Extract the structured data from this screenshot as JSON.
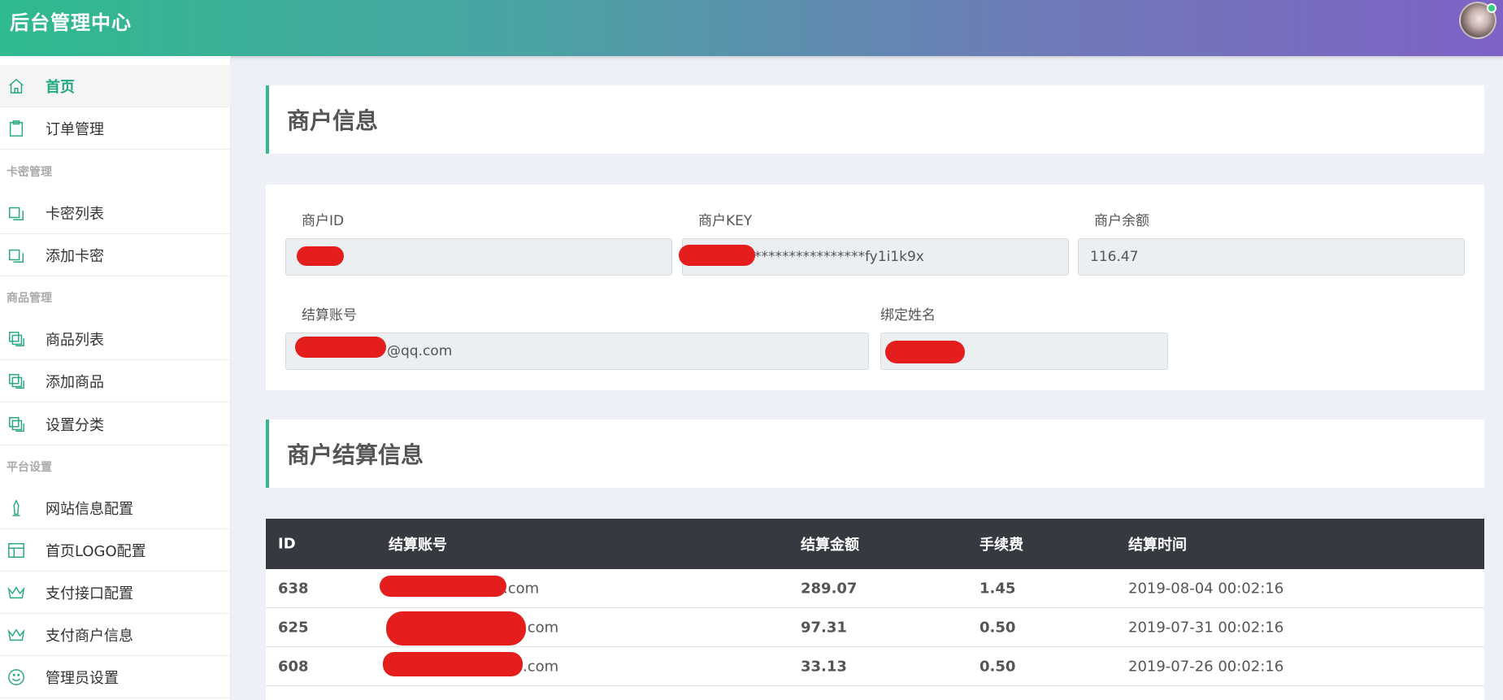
{
  "header": {
    "brand": "后台管理中心"
  },
  "sidebar": {
    "items": [
      {
        "label": "首页",
        "icon": "home-icon",
        "active": true
      },
      {
        "label": "订单管理",
        "icon": "clipboard-icon"
      },
      {
        "group": "卡密管理"
      },
      {
        "label": "卡密列表",
        "icon": "copy-icon"
      },
      {
        "label": "添加卡密",
        "icon": "copy-icon"
      },
      {
        "group": "商品管理"
      },
      {
        "label": "商品列表",
        "icon": "layers-icon"
      },
      {
        "label": "添加商品",
        "icon": "layers-icon"
      },
      {
        "label": "设置分类",
        "icon": "layers-icon"
      },
      {
        "group": "平台设置"
      },
      {
        "label": "网站信息配置",
        "icon": "pen-icon"
      },
      {
        "label": "首页LOGO配置",
        "icon": "layout-icon"
      },
      {
        "label": "支付接口配置",
        "icon": "crown-icon"
      },
      {
        "label": "支付商户信息",
        "icon": "crown-icon"
      },
      {
        "label": "管理员设置",
        "icon": "smile-icon"
      }
    ]
  },
  "merchant": {
    "title": "商户信息",
    "fields": {
      "id_label": "商户ID",
      "id_value": "",
      "key_label": "商户KEY",
      "key_value": "****************fy1i1k9x",
      "balance_label": "商户余额",
      "balance_value": "116.47",
      "account_label": "结算账号",
      "account_value": "@qq.com",
      "name_label": "绑定姓名",
      "name_value": ""
    }
  },
  "settlement": {
    "title": "商户结算信息",
    "columns": [
      "ID",
      "结算账号",
      "结算金额",
      "手续费",
      "结算时间"
    ],
    "rows": [
      {
        "id": "638",
        "account": ".com",
        "amount": "289.07",
        "fee": "1.45",
        "time": "2019-08-04 00:02:16"
      },
      {
        "id": "625",
        "account": ".com",
        "amount": "97.31",
        "fee": "0.50",
        "time": "2019-07-31 00:02:16"
      },
      {
        "id": "608",
        "account": ".com",
        "amount": "33.13",
        "fee": "0.50",
        "time": "2019-07-26 00:02:16"
      }
    ]
  },
  "colors": {
    "accent": "#21a882",
    "header_dark": "#363a40",
    "redaction": "#e41d1d"
  }
}
